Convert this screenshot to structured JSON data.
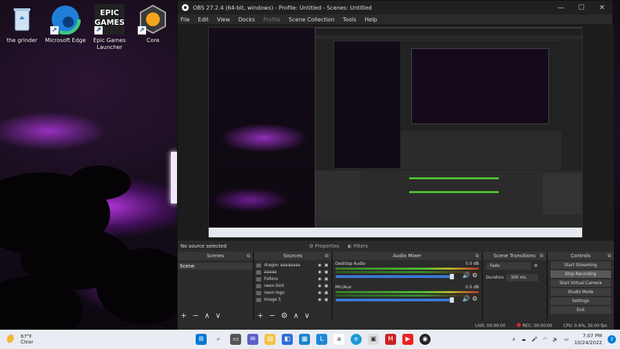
{
  "desktop": {
    "icons": [
      {
        "label": "the grinder",
        "icon": "recycle-bin-icon"
      },
      {
        "label": "Microsoft Edge",
        "icon": "edge-icon"
      },
      {
        "label": "Epic Games Launcher",
        "icon": "epic-games-icon",
        "badge": "EPIC GAMES"
      },
      {
        "label": "Core",
        "icon": "core-icon"
      }
    ]
  },
  "obs": {
    "title": "OBS 27.2.4 (64-bit, windows) - Profile: Untitled - Scenes: Untitled",
    "menu": [
      "File",
      "Edit",
      "View",
      "Docks",
      "Profile",
      "Scene Collection",
      "Tools",
      "Help"
    ],
    "window_controls": [
      "—",
      "☐",
      "✕"
    ],
    "status_text": "No source selected",
    "tabs": [
      "Properties",
      "Filters"
    ],
    "docks": {
      "scenes": {
        "title": "Scenes",
        "items": [
          "Scene"
        ]
      },
      "sources": {
        "title": "Sources",
        "items": [
          "dragon aaaaaaaa",
          "aaaaa",
          "Folloru",
          "neon bird",
          "neon logo",
          "Image 5"
        ]
      },
      "mixer": {
        "title": "Audio Mixer",
        "channels": [
          {
            "name": "Desktop Audio",
            "db": "0.0 dB"
          },
          {
            "name": "Mic/Aux",
            "db": "0.0 dB"
          }
        ]
      },
      "transitions": {
        "title": "Scene Transitions",
        "selected": "Fade",
        "duration_label": "Duration",
        "duration_value": "300 ms"
      },
      "controls": {
        "title": "Controls",
        "buttons": [
          "Start Streaming",
          "Stop Recording",
          "Start Virtual Camera",
          "Studio Mode",
          "Settings",
          "Exit"
        ]
      }
    },
    "statusbar": {
      "live": "LIVE: 00:00:00",
      "rec": "REC: 00:00:00",
      "cpu": "CPU: 0.6%, 30.00 fps"
    },
    "footer_symbols": [
      "+",
      "−",
      "∧",
      "∨"
    ],
    "source_footer_symbols": [
      "+",
      "−",
      "⚙",
      "∧",
      "∨"
    ]
  },
  "taskbar": {
    "weather": {
      "temp": "67°F",
      "desc": "Clear"
    },
    "time": "7:07 PM",
    "date": "10/24/2022",
    "notification_count": "3",
    "colors": {
      "accent": "#0078d4",
      "rec": "#dd2222"
    }
  }
}
